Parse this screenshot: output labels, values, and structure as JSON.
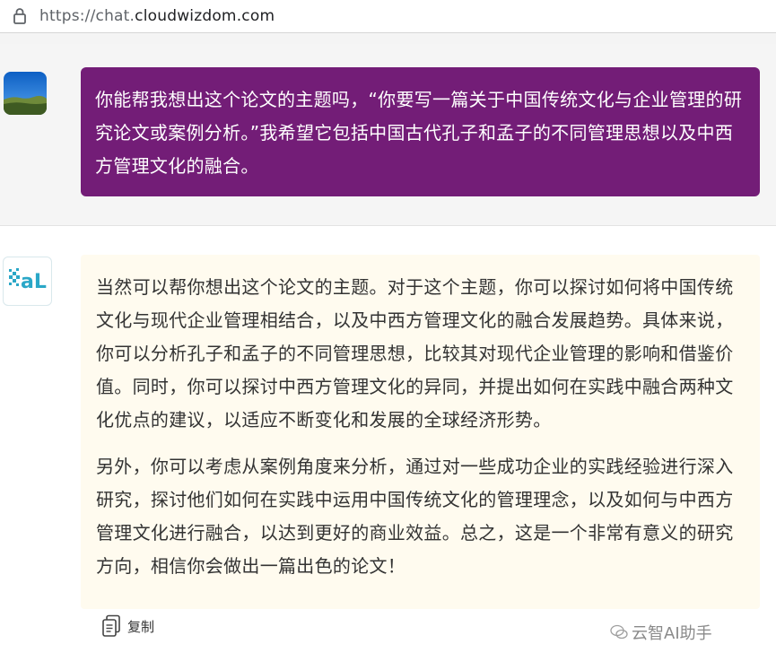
{
  "browser": {
    "url_scheme": "https://chat.",
    "url_host": "cloudwizdom.com"
  },
  "conversation": {
    "user_message": "你能帮我想出这个论文的主题吗，“你要写一篇关于中国传统文化与企业管理的研究论文或案例分析。”我希望它包括中国古代孔子和孟子的不同管理思想以及中西方管理文化的融合。",
    "ai_paragraphs": [
      "当然可以帮你想出这个论文的主题。对于这个主题，你可以探讨如何将中国传统文化与现代企业管理相结合，以及中西方管理文化的融合发展趋势。具体来说，你可以分析孔子和孟子的不同管理思想，比较其对现代企业管理的影响和借鉴价值。同时，你可以探讨中西方管理文化的异同，并提出如何在实践中融合两种文化优点的建议，以适应不断变化和发展的全球经济形势。",
      "另外，你可以考虑从案例角度来分析，通过对一些成功企业的实践经验进行深入研究，探讨他们如何在实践中运用中国传统文化的管理理念，以及如何与中西方管理文化进行融合，以达到更好的商业效益。总之，这是一个非常有意义的研究方向，相信你会做出一篇出色的论文！"
    ]
  },
  "actions": {
    "copy_label": "复制"
  },
  "watermark": {
    "text": "云智AI助手"
  },
  "colors": {
    "user_bubble": "#731d77",
    "ai_bubble": "#fffbef",
    "ai_logo": "#2aa7c7"
  },
  "icons": {
    "lock": "lock-icon",
    "copy": "copy-icon",
    "ai_logo": "ai-logo-icon",
    "user_avatar": "landscape-avatar",
    "watermark": "wechat-icon"
  }
}
